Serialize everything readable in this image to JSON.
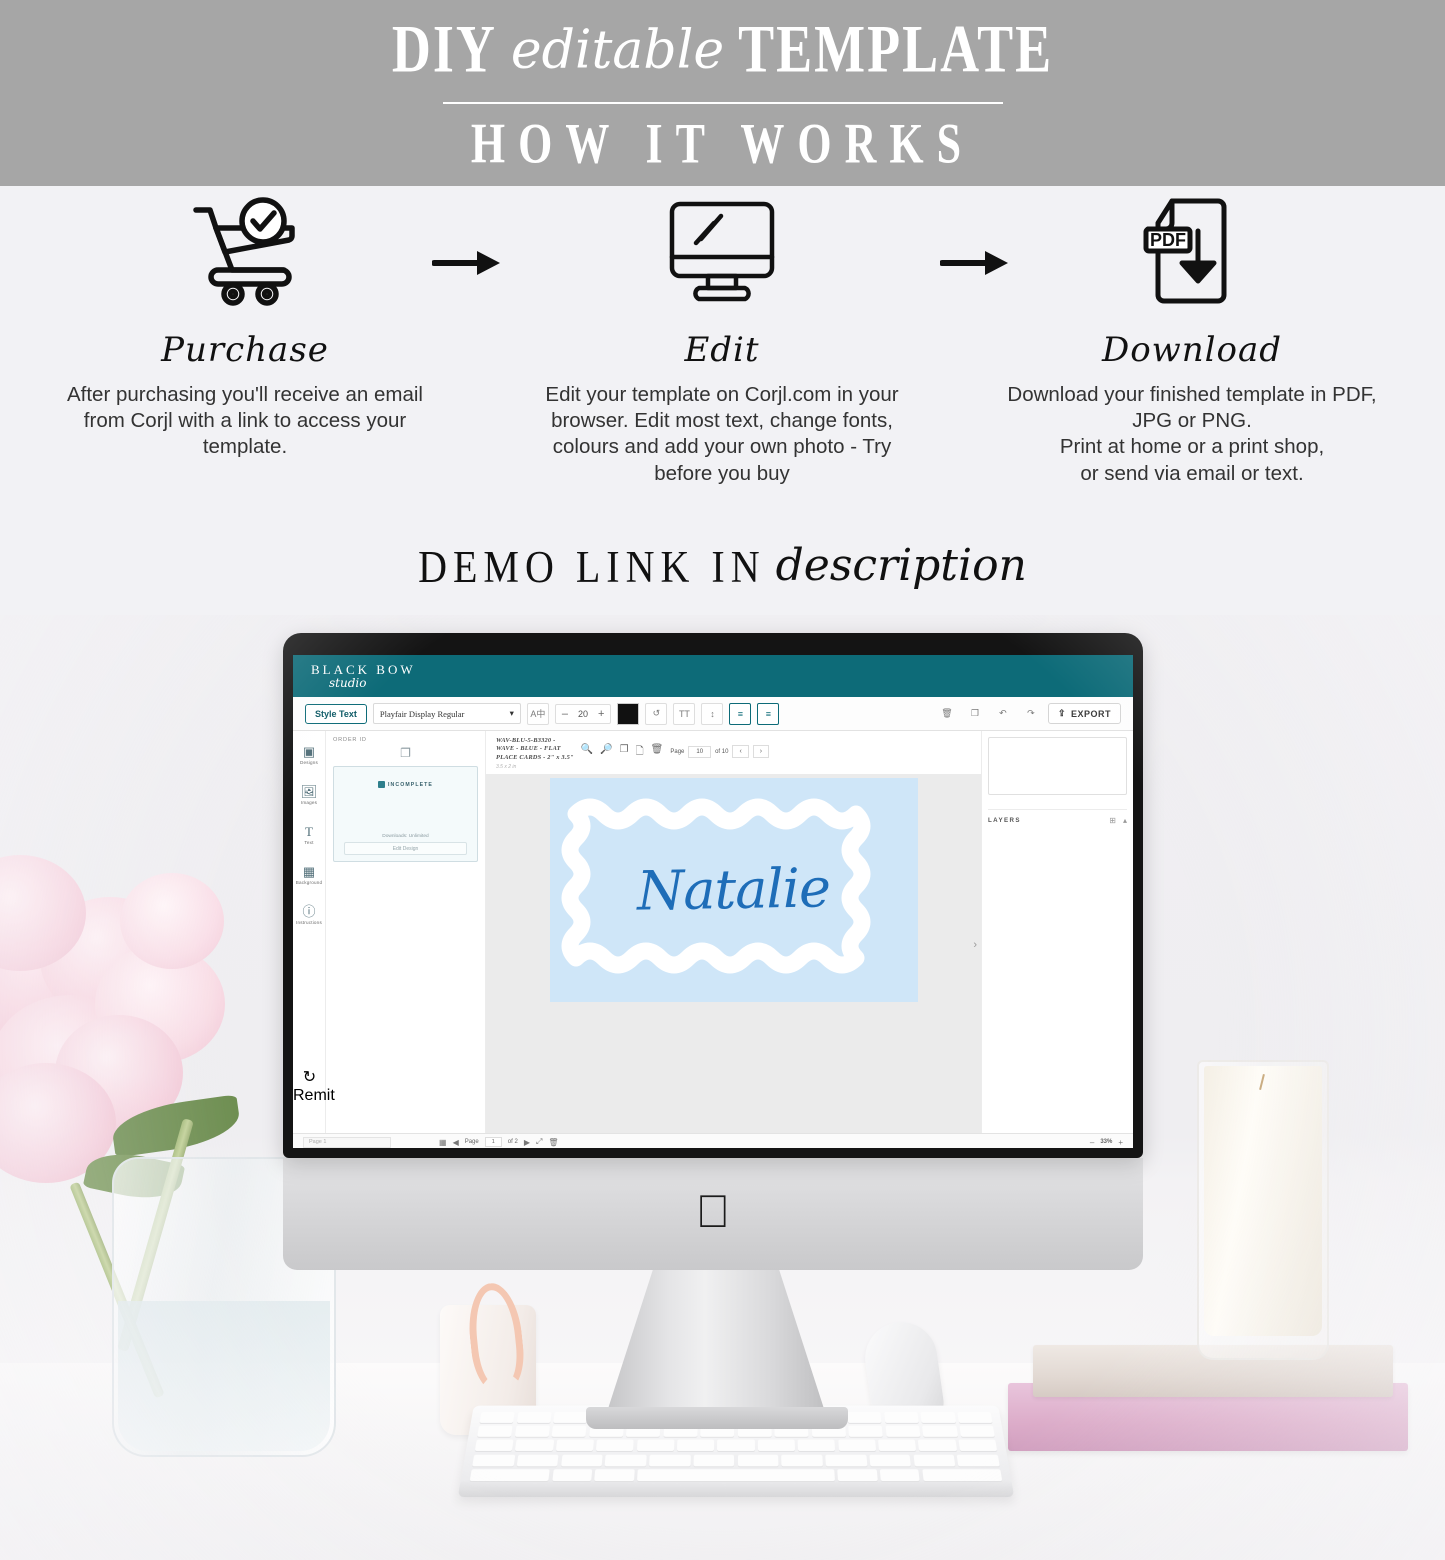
{
  "banner": {
    "title_part1": "DIY",
    "title_script": "editable",
    "title_part2": "TEMPLATE",
    "subtitle": "HOW IT WORKS"
  },
  "steps": [
    {
      "icon": "shopping-cart-check-icon",
      "heading": "Purchase",
      "body": "After purchasing you'll receive an email from Corjl with a link to access your template."
    },
    {
      "icon": "desktop-monitor-edit-icon",
      "heading": "Edit",
      "body": "Edit your template on Corjl.com in your browser. Edit most text, change fonts, colours and add your own photo - Try before you buy"
    },
    {
      "icon": "pdf-download-icon",
      "heading": "Download",
      "body": "Download your finished template in PDF, JPG or PNG.\nPrint at home or a print shop,\nor send via email or text."
    }
  ],
  "demo": {
    "serif": "DEMO LINK IN",
    "script": "description"
  },
  "app": {
    "brand_main": "BLACK BOW",
    "brand_sub": "studio",
    "toolbar": {
      "style_text": "Style Text",
      "font_family": "Playfair Display Regular",
      "font_size": "20",
      "minus": "–",
      "plus": "+",
      "color_hex": "#111111",
      "export": "EXPORT"
    },
    "rail": [
      {
        "label": "Designs",
        "icon": "designs-icon"
      },
      {
        "label": "Images",
        "icon": "images-icon"
      },
      {
        "label": "Text",
        "icon": "text-icon"
      },
      {
        "label": "Background",
        "icon": "background-icon"
      },
      {
        "label": "Instructions",
        "icon": "info-icon"
      }
    ],
    "rail_bottom": {
      "label": "Remit",
      "icon": "refresh-icon"
    },
    "left_panel": {
      "title": "ORDER ID",
      "status_badge": "INCOMPLETE",
      "downloads": "Downloads: Unlimited",
      "edit_design": "Edit Design"
    },
    "canvas_header": {
      "title_line1": "WAV-BLU-5-B3320 -",
      "title_line2": "WAVE - BLUE - FLAT",
      "title_line3": "PLACE CARDS - 2\" x 3.5\"",
      "dims": "3.5 x 2 in",
      "page_label": "Page",
      "page_value": "10",
      "page_of": "of 10",
      "prev": "‹",
      "next": "›"
    },
    "card": {
      "name": "Natalie",
      "bg_color": "#a7d3f5",
      "border_color": "#ffffff",
      "text_color": "#1e6db8"
    },
    "right_panel": {
      "layers_label": "LAYERS"
    },
    "bottom_bar": {
      "page_placeholder": "Page 1",
      "page_label": "Page",
      "page_value": "1",
      "page_of": "of 2",
      "zoom_minus": "–",
      "zoom_value": "33%",
      "zoom_plus": "+"
    }
  },
  "colors": {
    "banner_bg": "#a6a6a6",
    "page_bg": "#f2f2f5",
    "teal": "#0d6b78",
    "card_blue": "#a7d3f5"
  }
}
